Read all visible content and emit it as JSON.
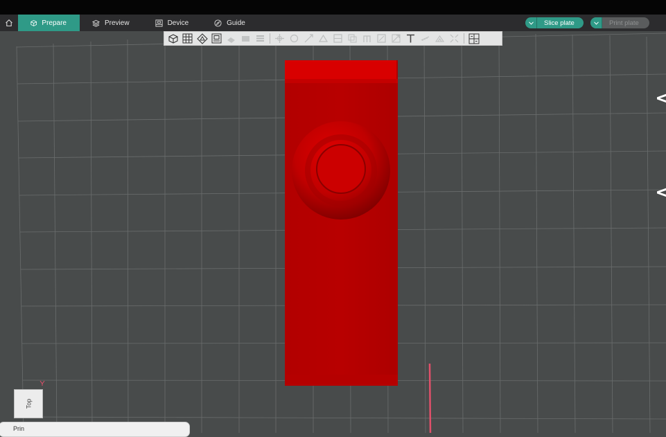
{
  "menubar": {
    "tabs": [
      {
        "label": "Prepare",
        "icon": "cube-outline-icon",
        "active": true
      },
      {
        "label": "Preview",
        "icon": "layers-icon",
        "active": false
      },
      {
        "label": "Device",
        "icon": "device-icon",
        "active": false
      },
      {
        "label": "Guide",
        "icon": "compass-icon",
        "active": false
      }
    ],
    "slice_label": "Slice plate",
    "print_label": "Print plate"
  },
  "toolbar": {
    "tools": [
      "add-cube",
      "arrange-grid",
      "orient",
      "plate-settings",
      "move",
      "rotate",
      "scale",
      "cut",
      "support",
      "seam",
      "paint",
      "text",
      "measure",
      "assembly"
    ]
  },
  "viewport": {
    "view_label": "Top",
    "bottom_panel_text": "Prin",
    "model_color": "#cc0000",
    "axis_color": "#e0506a",
    "accent": "#2f9a87"
  }
}
